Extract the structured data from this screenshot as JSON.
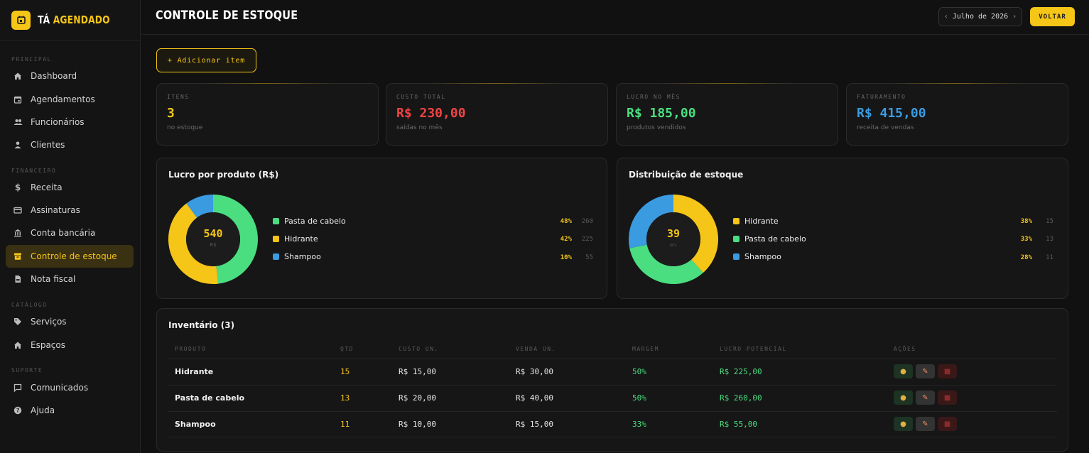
{
  "brand": {
    "word1": "TÁ",
    "word2": "AGENDADO"
  },
  "sidebar": {
    "sections": {
      "principal": "PRINCIPAL",
      "financeiro": "FINANCEIRO",
      "catalogo": "CATÁLOGO",
      "suporte": "SUPORTE"
    },
    "items": [
      {
        "label": "Dashboard",
        "icon": "home-icon"
      },
      {
        "label": "Agendamentos",
        "icon": "calendar-icon"
      },
      {
        "label": "Funcionários",
        "icon": "users-icon"
      },
      {
        "label": "Clientes",
        "icon": "user-icon"
      },
      {
        "label": "Receita",
        "icon": "dollar-icon"
      },
      {
        "label": "Assinaturas",
        "icon": "card-icon"
      },
      {
        "label": "Conta bancária",
        "icon": "bank-icon"
      },
      {
        "label": "Controle de estoque",
        "icon": "inventory-icon",
        "active": true
      },
      {
        "label": "Nota fiscal",
        "icon": "document-icon"
      },
      {
        "label": "Serviços",
        "icon": "tag-icon"
      },
      {
        "label": "Espaços",
        "icon": "home-icon"
      },
      {
        "label": "Comunicados",
        "icon": "chat-icon"
      },
      {
        "label": "Ajuda",
        "icon": "help-icon"
      }
    ]
  },
  "header": {
    "title": "CONTROLE DE ESTOQUE",
    "month": "Julho de 2026",
    "back_label": "VOLTAR"
  },
  "add_item_label": "+ Adicionar item",
  "stats": [
    {
      "label": "ITENS",
      "value": "3",
      "sub": "no estoque",
      "color": "#f5c518"
    },
    {
      "label": "CUSTO TOTAL",
      "value": "R$ 230,00",
      "sub": "saídas no mês",
      "color": "#ef4444"
    },
    {
      "label": "LUCRO NO MÊS",
      "value": "R$ 185,00",
      "sub": "produtos vendidos",
      "color": "#4ade80"
    },
    {
      "label": "FATURAMENTO",
      "value": "R$ 415,00",
      "sub": "receita de vendas",
      "color": "#3b9be0"
    }
  ],
  "charts": {
    "profit": {
      "title": "Lucro por produto (R$)",
      "center_value": "540",
      "center_unit": "R$",
      "legend": [
        {
          "name": "Pasta de cabelo",
          "pct": "48%",
          "value": "260",
          "color": "#4ade80"
        },
        {
          "name": "Hidrante",
          "pct": "42%",
          "value": "225",
          "color": "#f5c518"
        },
        {
          "name": "Shampoo",
          "pct": "10%",
          "value": "55",
          "color": "#3b9be0"
        }
      ]
    },
    "stock": {
      "title": "Distribuição de estoque",
      "center_value": "39",
      "center_unit": "un.",
      "legend": [
        {
          "name": "Hidrante",
          "pct": "38%",
          "value": "15",
          "color": "#f5c518"
        },
        {
          "name": "Pasta de cabelo",
          "pct": "33%",
          "value": "13",
          "color": "#4ade80"
        },
        {
          "name": "Shampoo",
          "pct": "28%",
          "value": "11",
          "color": "#3b9be0"
        }
      ]
    }
  },
  "chart_data": [
    {
      "type": "pie",
      "title": "Lucro por produto (R$)",
      "categories": [
        "Pasta de cabelo",
        "Hidrante",
        "Shampoo"
      ],
      "values": [
        260,
        225,
        55
      ],
      "total": 540
    },
    {
      "type": "pie",
      "title": "Distribuição de estoque",
      "categories": [
        "Hidrante",
        "Pasta de cabelo",
        "Shampoo"
      ],
      "values": [
        15,
        13,
        11
      ],
      "total": 39
    }
  ],
  "inventory": {
    "title": "Inventário (3)",
    "columns": [
      "PRODUTO",
      "QTD",
      "CUSTO UN.",
      "VENDA UN.",
      "MARGEM",
      "LUCRO POTENCIAL",
      "AÇÕES"
    ],
    "rows": [
      {
        "produto": "Hidrante",
        "qtd": "15",
        "custo": "R$ 15,00",
        "venda": "R$ 30,00",
        "margem": "50%",
        "lucro": "R$ 225,00"
      },
      {
        "produto": "Pasta de cabelo",
        "qtd": "13",
        "custo": "R$ 20,00",
        "venda": "R$ 40,00",
        "margem": "50%",
        "lucro": "R$ 260,00"
      },
      {
        "produto": "Shampoo",
        "qtd": "11",
        "custo": "R$ 10,00",
        "venda": "R$ 15,00",
        "margem": "33%",
        "lucro": "R$ 55,00"
      }
    ],
    "actions": {
      "sell_icon": "money-bag-icon",
      "edit_icon": "pencil-icon",
      "delete_icon": "trash-icon"
    }
  }
}
